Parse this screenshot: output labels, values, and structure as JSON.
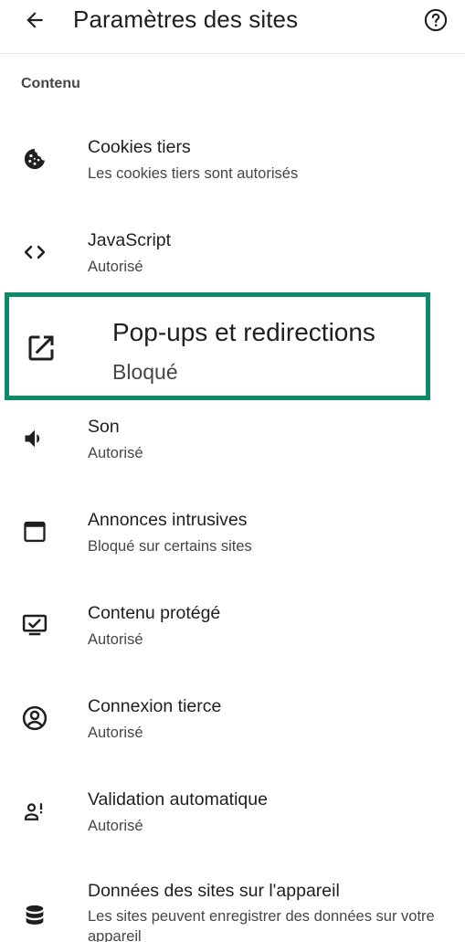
{
  "header": {
    "title": "Paramètres des sites",
    "back_icon": "arrow-back-icon",
    "help_icon": "help-circle-icon"
  },
  "section": {
    "title": "Contenu"
  },
  "items": [
    {
      "label": "Cookies tiers",
      "status": "Les cookies tiers sont autorisés",
      "icon": "cookie-icon"
    },
    {
      "label": "JavaScript",
      "status": "Autorisé",
      "icon": "code-icon"
    },
    {
      "label": "Pop-ups et redirections",
      "status": "Bloqué",
      "icon": "open-in-new-icon",
      "highlighted": true
    },
    {
      "label": "Son",
      "status": "Autorisé",
      "icon": "volume-icon"
    },
    {
      "label": "Annonces intrusives",
      "status": "Bloqué sur certains sites",
      "icon": "window-icon"
    },
    {
      "label": "Contenu protégé",
      "status": "Autorisé",
      "icon": "protected-content-icon"
    },
    {
      "label": "Connexion tierce",
      "status": "Autorisé",
      "icon": "account-circle-icon"
    },
    {
      "label": "Validation automatique",
      "status": "Autorisé",
      "icon": "person-alert-icon"
    },
    {
      "label": "Données des sites sur l'appareil",
      "status": "Les sites peuvent enregistrer des données sur votre appareil",
      "icon": "database-icon"
    }
  ],
  "colors": {
    "highlight_border": "#0c8a6a",
    "text_primary": "#1f1f1f",
    "text_secondary": "#444746"
  }
}
